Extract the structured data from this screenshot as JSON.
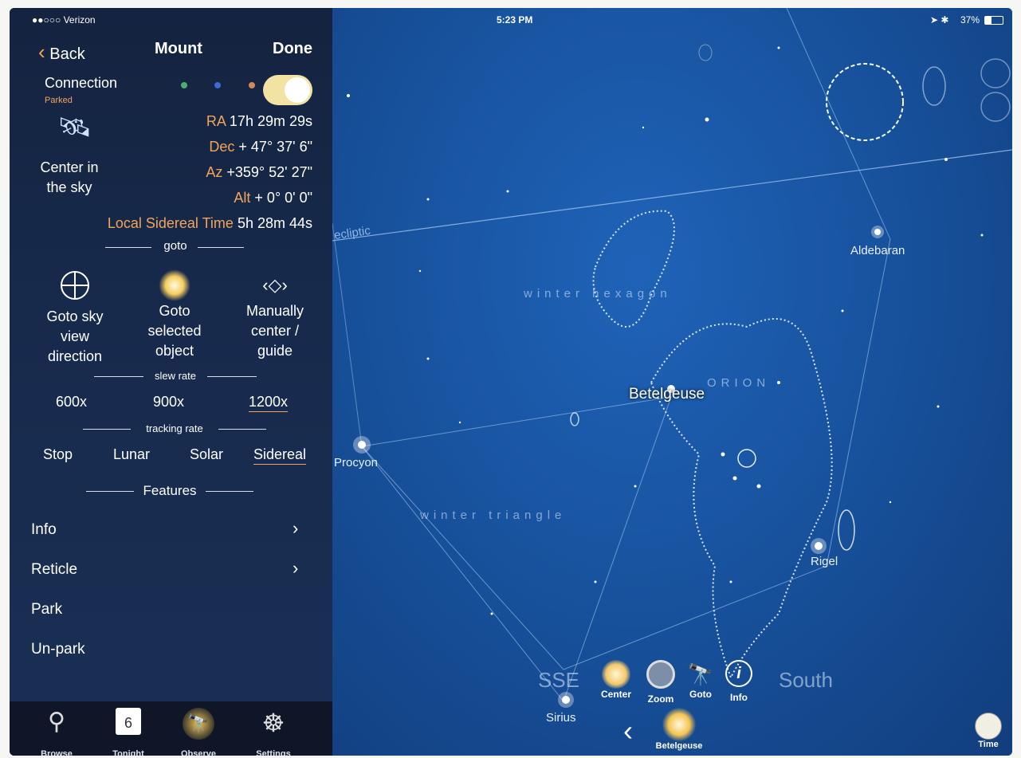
{
  "status_bar": {
    "carrier": "●●○○○ Verizon",
    "time": "5:23 PM",
    "battery": "37%"
  },
  "nav": {
    "back": "Back",
    "title": "Mount",
    "done": "Done"
  },
  "connection": {
    "label": "Connection",
    "state": "Parked",
    "toggle_on": true,
    "center_label": "Center in the sky"
  },
  "coords": {
    "ra_label": "RA",
    "ra_value": "17h 29m 29s",
    "dec_label": "Dec",
    "dec_value": "+ 47° 37'  6\"",
    "az_label": "Az",
    "az_value": "+359° 52' 27\"",
    "alt_label": "Alt",
    "alt_value": "+  0°  0'  0\"",
    "lst_label": "Local Sidereal Time",
    "lst_value": "5h 28m 44s"
  },
  "goto": {
    "header": "goto",
    "items": [
      {
        "label": "Goto sky view direction",
        "icon": "crosshair-icon"
      },
      {
        "label": "Goto selected object",
        "icon": "star-icon"
      },
      {
        "label": "Manually center / guide",
        "icon": "move-arrows-icon"
      }
    ]
  },
  "slew": {
    "header": "slew rate",
    "options": [
      "600x",
      "900x",
      "1200x"
    ],
    "selected": "1200x"
  },
  "tracking": {
    "header": "tracking rate",
    "options": [
      "Stop",
      "Lunar",
      "Solar",
      "Sidereal"
    ],
    "selected": "Sidereal"
  },
  "features": {
    "header": "Features",
    "items": [
      {
        "label": "Info",
        "chevron": true
      },
      {
        "label": "Reticle",
        "chevron": true
      },
      {
        "label": "Park",
        "chevron": false
      },
      {
        "label": "Un-park",
        "chevron": false
      }
    ]
  },
  "tabs": [
    {
      "label": "Browse",
      "icon": "magnifier-icon"
    },
    {
      "label": "Tonight",
      "icon": "calendar-icon",
      "badge": "6"
    },
    {
      "label": "Observe",
      "icon": "telescope-icon"
    },
    {
      "label": "Settings",
      "icon": "wheel-icon"
    }
  ],
  "sky": {
    "labels": {
      "ecliptic": "ecliptic",
      "aldebaran": "Aldebaran",
      "betelgeuse": "Betelgeuse",
      "procyon": "Procyon",
      "rigel": "Rigel",
      "sirius": "Sirius",
      "winter_hexagon": "winter hexagon",
      "winter_triangle": "winter triangle",
      "orion": "ORION",
      "sse": "SSE",
      "south": "South"
    },
    "toolbar": [
      "Center",
      "Zoom",
      "Goto",
      "Info"
    ],
    "selected_object": "Betelgeuse",
    "time_label": "Time"
  }
}
